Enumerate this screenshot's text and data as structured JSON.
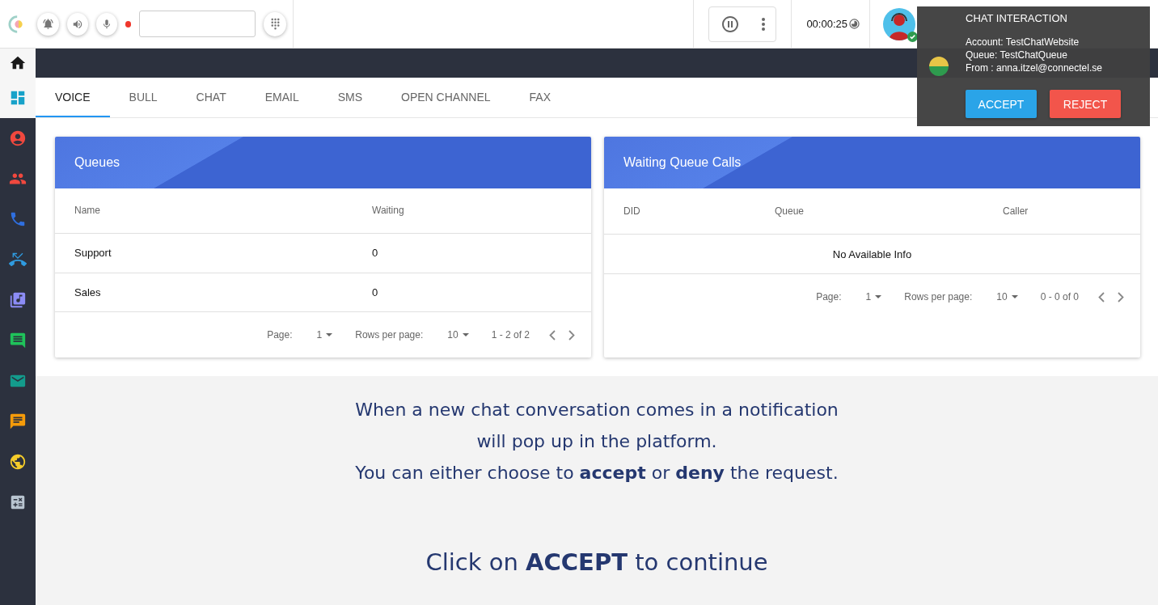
{
  "header": {
    "recording": true,
    "timer": "00:00:25"
  },
  "sidebar": {
    "items": [
      {
        "kind": "home",
        "color": "#1a1a1a",
        "selected": true
      },
      {
        "kind": "dashboard",
        "color": "#17a2c9",
        "selected": true
      },
      {
        "kind": "contact",
        "color": "#f0483e",
        "selected": false
      },
      {
        "kind": "people",
        "color": "#f0483e",
        "selected": false
      },
      {
        "kind": "phone",
        "color": "#2f6fe0",
        "selected": false
      },
      {
        "kind": "missed",
        "color": "#2f9be0",
        "selected": false
      },
      {
        "kind": "music",
        "color": "#8c8cf5",
        "selected": false
      },
      {
        "kind": "quote",
        "color": "#1fc25a",
        "selected": false
      },
      {
        "kind": "email",
        "color": "#139b8c",
        "selected": false
      },
      {
        "kind": "chat",
        "color": "#f59b0a",
        "selected": false
      },
      {
        "kind": "globe",
        "color": "#f5cc2a",
        "selected": false
      },
      {
        "kind": "calculator",
        "color": "#b8c4d0",
        "selected": false
      }
    ]
  },
  "tabs": [
    {
      "label": "VOICE",
      "selected": true
    },
    {
      "label": "BULL",
      "selected": false
    },
    {
      "label": "CHAT",
      "selected": false
    },
    {
      "label": "EMAIL",
      "selected": false
    },
    {
      "label": "SMS",
      "selected": false
    },
    {
      "label": "OPEN CHANNEL",
      "selected": false
    },
    {
      "label": "FAX",
      "selected": false
    }
  ],
  "cards": [
    {
      "title": "Queues",
      "columns": [
        "Name",
        "Waiting"
      ],
      "rows": [
        [
          "Support",
          "0"
        ],
        [
          "Sales",
          "0"
        ]
      ],
      "pagination": {
        "page_label": "Page:",
        "page": "1",
        "rows_label": "Rows per page:",
        "rows": "10",
        "range": "1 - 2 of 2"
      }
    },
    {
      "title": "Waiting Queue Calls",
      "columns": [
        "DID",
        "Queue",
        "Caller"
      ],
      "empty_text": "No Available Info",
      "pagination": {
        "page_label": "Page:",
        "page": "1",
        "rows_label": "Rows per page:",
        "rows": "10",
        "range": "0 - 0 of 0"
      }
    }
  ],
  "tutorial": {
    "paragraphs": [
      "When a new chat conversation comes in a notification will pop up in the platform.",
      "You can either choose to **accept** or **deny** the request."
    ],
    "call_to_action": "Click on **ACCEPT** to continue"
  },
  "notification": {
    "title": "CHAT INTERACTION",
    "lines": [
      "Account: TestChatWebsite",
      "Queue: TestChatQueue",
      "From : anna.itzel@connectel.se"
    ],
    "accept": "ACCEPT",
    "reject": "REJECT"
  }
}
